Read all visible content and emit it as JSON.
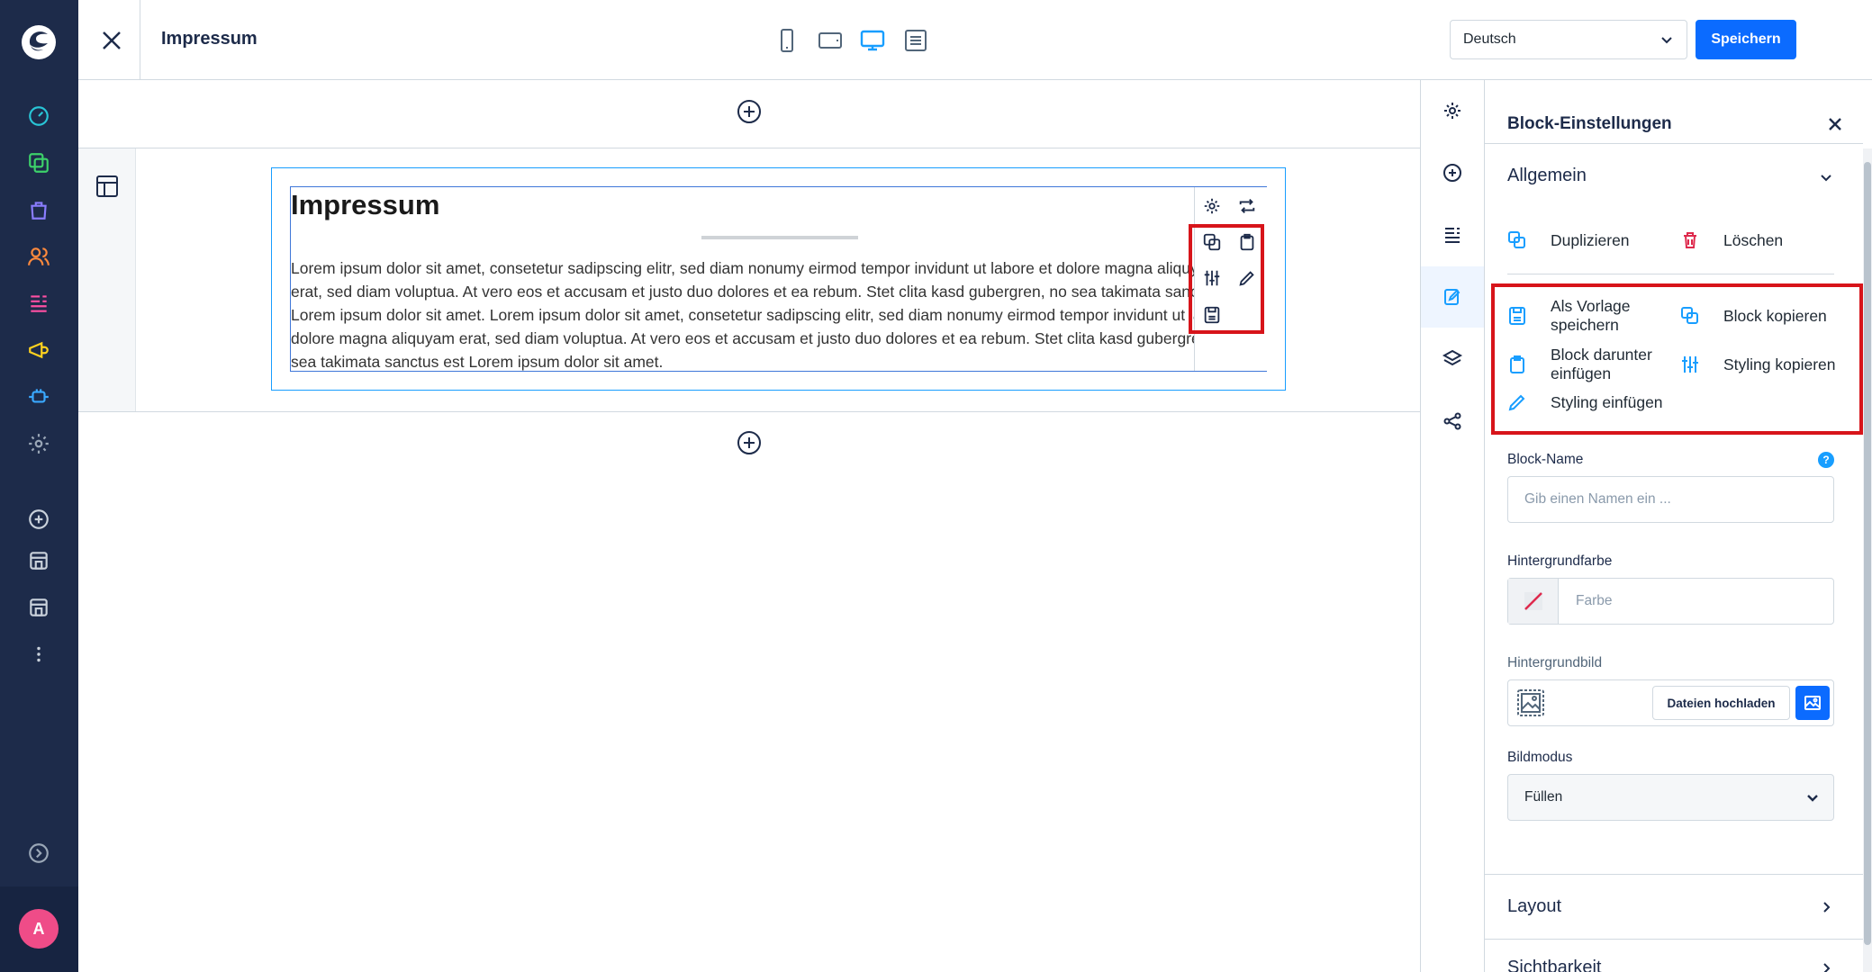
{
  "topbar": {
    "title": "Impressum",
    "language": "Deutsch",
    "save_label": "Speichern"
  },
  "block": {
    "heading": "Impressum",
    "text": "Lorem ipsum dolor sit amet, consetetur sadipscing elitr, sed diam nonumy eirmod tempor invidunt ut labore et dolore magna aliquyam erat, sed diam voluptua. At vero eos et accusam et justo duo dolores et ea rebum. Stet clita kasd gubergren, no sea takimata sanctus est Lorem ipsum dolor sit amet. Lorem ipsum dolor sit amet, consetetur sadipscing elitr, sed diam nonumy eirmod tempor invidunt ut labore et dolore magna aliquyam erat, sed diam voluptua. At vero eos et accusam et justo duo dolores et ea rebum. Stet clita kasd gubergren, no sea takimata sanctus est Lorem ipsum dolor sit amet."
  },
  "panel": {
    "title": "Block-Einstellungen",
    "general": "Allgemein",
    "duplicate": "Duplizieren",
    "delete": "Löschen",
    "save_template": "Als Vorlage speichern",
    "copy_block": "Block kopieren",
    "paste_below": "Block darunter einfügen",
    "copy_styling": "Styling kopieren",
    "paste_styling": "Styling einfügen",
    "block_name_label": "Block-Name",
    "block_name_placeholder": "Gib einen Namen ein ...",
    "bg_color_label": "Hintergrundfarbe",
    "bg_color_placeholder": "Farbe",
    "bg_image_label": "Hintergrundbild",
    "upload_label": "Dateien hochladen",
    "image_mode_label": "Bildmodus",
    "image_mode_value": "Füllen",
    "layout": "Layout",
    "visibility": "Sichtbarkeit"
  },
  "colors": {
    "brand_blue": "#0b6bff",
    "nav_bg": "#1d2b4a",
    "highlight_red": "#d7141a",
    "avatar_pink": "#ef4c88"
  },
  "user": {
    "avatar_initial": "A"
  }
}
